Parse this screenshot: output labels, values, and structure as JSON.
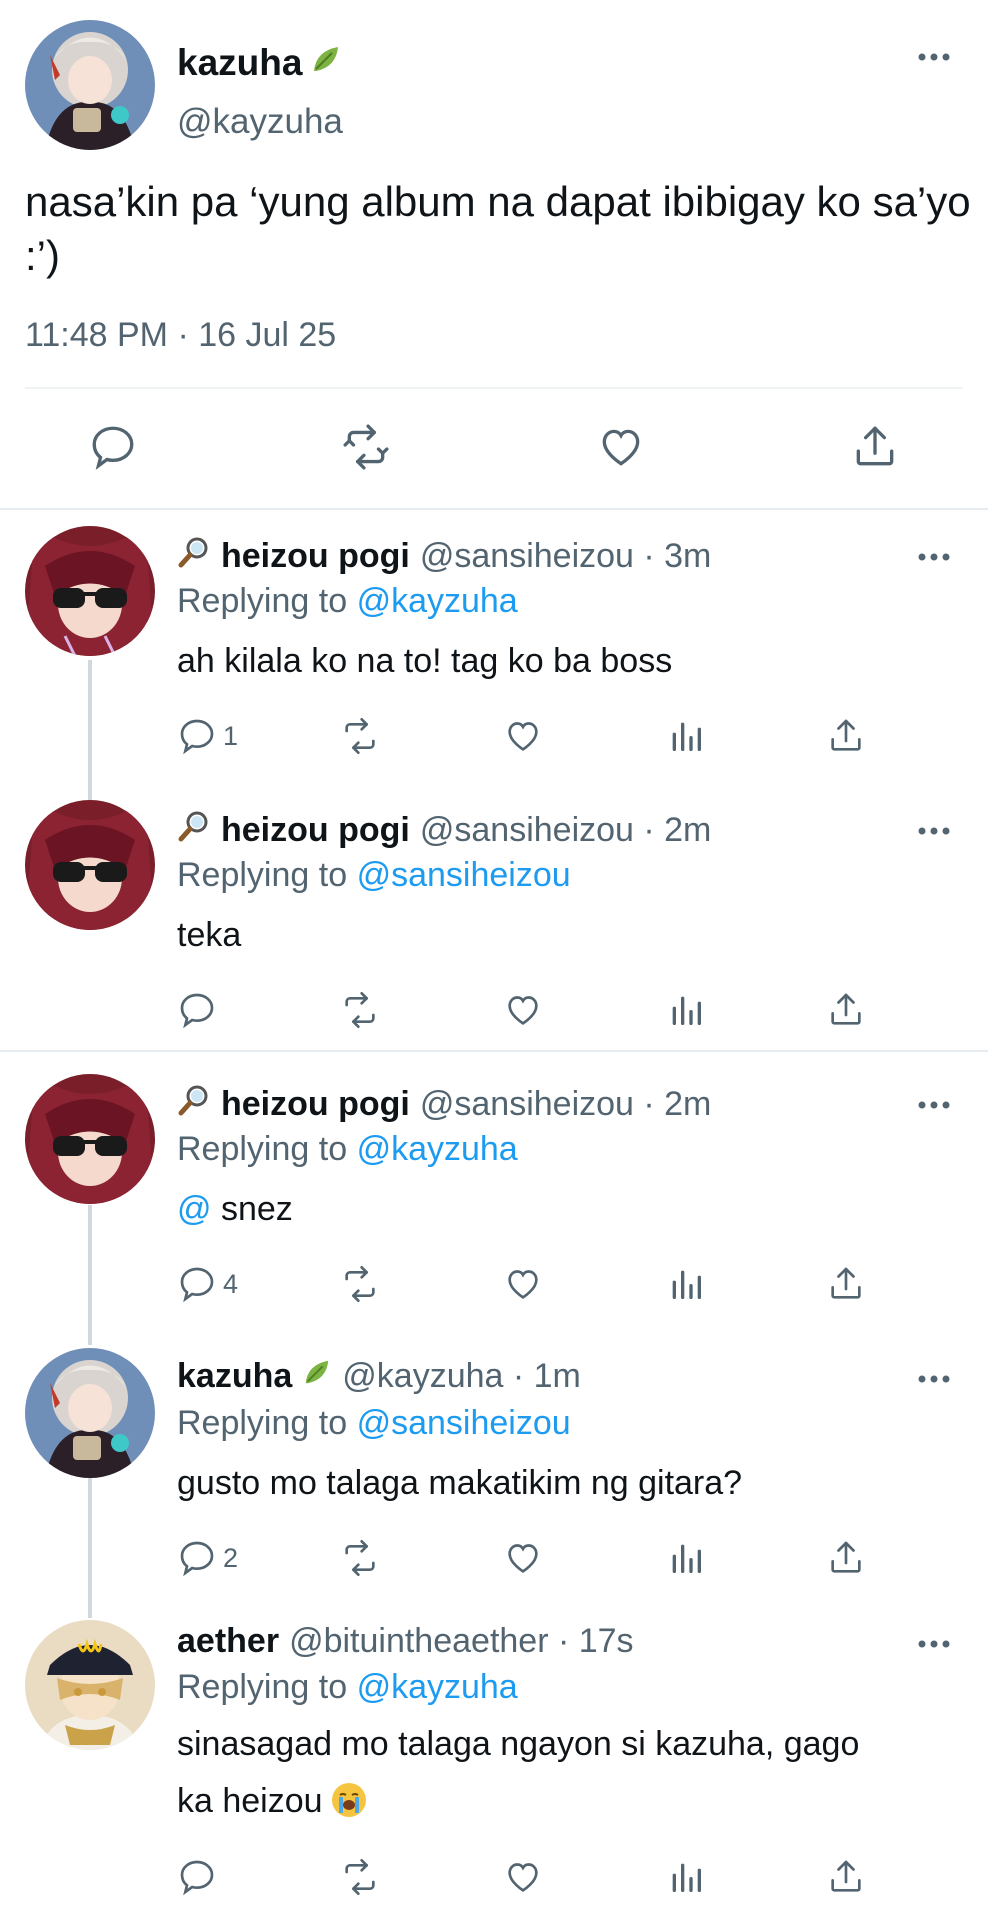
{
  "main_tweet": {
    "display_name": "kazuha",
    "name_emoji": "leaf-emoji",
    "handle": "@kayzuha",
    "text": "nasa’kin pa ‘yung album na dapat ibibigay ko sa’yo :’)",
    "timestamp": "11:48 PM · 16 Jul 25",
    "actions": [
      "reply-icon",
      "retweet-icon",
      "like-icon",
      "share-icon"
    ]
  },
  "replies": [
    {
      "name_prefix_icon": "magnifier-emoji",
      "display_name": "heizou pogi",
      "handle_time": "@sansiheizou · 3m",
      "replying_label": "Replying to",
      "replying_to": "@kayzuha",
      "text": "ah kilala ko na to! tag ko ba boss",
      "reply_count": "1"
    },
    {
      "name_prefix_icon": "magnifier-emoji",
      "display_name": "heizou pogi",
      "handle_time": "@sansiheizou · 2m",
      "replying_label": "Replying to",
      "replying_to": "@sansiheizou",
      "text": "teka",
      "reply_count": ""
    },
    {
      "name_prefix_icon": "magnifier-emoji",
      "display_name": "heizou pogi",
      "handle_time": "@sansiheizou · 2m",
      "replying_label": "Replying to",
      "replying_to": "@kayzuha",
      "mention": "@",
      "text": "snez",
      "reply_count": "4"
    },
    {
      "name_suffix_icon": "leaf-emoji",
      "display_name": "kazuha",
      "handle_time": "@kayzuha · 1m",
      "replying_label": "Replying to",
      "replying_to": "@sansiheizou",
      "text": "gusto mo talaga makatikim ng gitara?",
      "reply_count": "2"
    },
    {
      "display_name": "aether",
      "handle_time": "@bituintheaether · 17s",
      "replying_label": "Replying to",
      "replying_to": "@kayzuha",
      "text_line1": "sinasagad mo talaga ngayon si kazuha, gago",
      "text_line2": "ka heizou",
      "text_emoji": "loudly-crying-face-emoji",
      "reply_count": ""
    }
  ],
  "colors": {
    "link": "#1d9bf0",
    "secondary_text": "#536471",
    "primary_text": "#0f1419",
    "divider": "#e6ecf0"
  }
}
